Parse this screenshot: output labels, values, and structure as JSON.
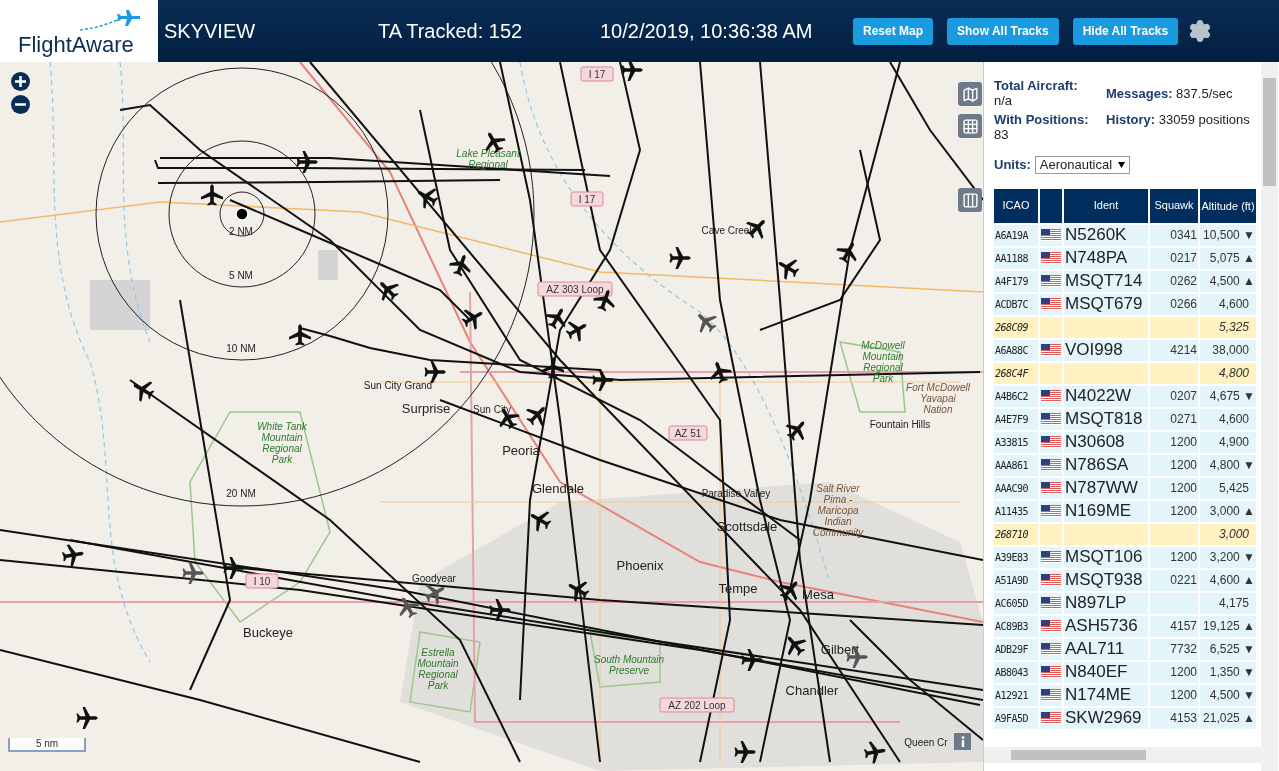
{
  "header": {
    "logo": "FlightAware",
    "title": "SKYVIEW",
    "tracked": "TA Tracked: 152",
    "datetime": "10/2/2019, 10:36:38 AM",
    "buttons": [
      "Reset Map",
      "Show All Tracks",
      "Hide All Tracks"
    ]
  },
  "map": {
    "scale": "5 nm",
    "labels": [
      {
        "kind": "road",
        "text": "I 17"
      },
      {
        "kind": "park",
        "text": "Lake Pleasant\nRegional"
      },
      {
        "kind": "road",
        "text": "I 17"
      },
      {
        "kind": "city",
        "text": "Cave Creek"
      },
      {
        "kind": "road",
        "text": "AZ 303 Loop"
      },
      {
        "kind": "city",
        "text": "Sun City Grand"
      },
      {
        "kind": "bigcity",
        "text": "Surprise"
      },
      {
        "kind": "city",
        "text": "Sun City"
      },
      {
        "kind": "park",
        "text": "McDowell\nMountain\nRegional\nPark"
      },
      {
        "kind": "reservation",
        "text": "Fort McDowell\nYavapai\nNation"
      },
      {
        "kind": "city",
        "text": "Fountain Hills"
      },
      {
        "kind": "park",
        "text": "White Tank\nMountain\nRegional\nPark"
      },
      {
        "kind": "bigcity",
        "text": "Peoria"
      },
      {
        "kind": "road",
        "text": "AZ 51"
      },
      {
        "kind": "bigcity",
        "text": "Glendale"
      },
      {
        "kind": "city",
        "text": "Paradise Valley"
      },
      {
        "kind": "reservation",
        "text": "Salt River\nPima -\nMaricopa\nIndian\nCommunity"
      },
      {
        "kind": "bigcity",
        "text": "Scottsdale"
      },
      {
        "kind": "bigcity",
        "text": "Phoenix"
      },
      {
        "kind": "road",
        "text": "I 10"
      },
      {
        "kind": "city",
        "text": "Goodyear"
      },
      {
        "kind": "bigcity",
        "text": "Tempe"
      },
      {
        "kind": "bigcity",
        "text": "Mesa"
      },
      {
        "kind": "bigcity",
        "text": "Buckeye"
      },
      {
        "kind": "park",
        "text": "Estrella\nMountain\nRegional\nPark"
      },
      {
        "kind": "park",
        "text": "South Mountain\nPreserve"
      },
      {
        "kind": "bigcity",
        "text": "Gilbert"
      },
      {
        "kind": "bigcity",
        "text": "Chandler"
      },
      {
        "kind": "road",
        "text": "AZ 202 Loop"
      },
      {
        "kind": "city",
        "text": "Queen Cr"
      },
      {
        "kind": "ring",
        "text": "2 NM"
      },
      {
        "kind": "ring",
        "text": "5 NM"
      },
      {
        "kind": "ring",
        "text": "10 NM"
      },
      {
        "kind": "ring",
        "text": "20 NM"
      }
    ]
  },
  "stats": [
    {
      "label": "Total Aircraft:",
      "value": "n/a"
    },
    {
      "label": "Messages:",
      "value": "837.5/sec"
    },
    {
      "label": "With Positions:",
      "value": "83"
    },
    {
      "label": "History:",
      "value": "33059 positions"
    }
  ],
  "units": {
    "label": "Units:",
    "value": "Aeronautical"
  },
  "table": {
    "columns": [
      "ICAO",
      "Ident",
      "Squawk",
      "Altitude (ft)"
    ],
    "rows": [
      {
        "icao": "A6A19A",
        "flag": true,
        "ident": "N5260K",
        "squawk": "0341",
        "altitude": "10,500",
        "trend": "▼",
        "highlighted": false
      },
      {
        "icao": "AA1188",
        "flag": true,
        "ident": "N748PA",
        "squawk": "0217",
        "altitude": "5,075",
        "trend": "▲",
        "highlighted": false
      },
      {
        "icao": "A4F179",
        "flag": true,
        "ident": "MSQT714",
        "squawk": "0262",
        "altitude": "4,500",
        "trend": "▲",
        "highlighted": false
      },
      {
        "icao": "ACDB7C",
        "flag": true,
        "ident": "MSQT679",
        "squawk": "0266",
        "altitude": "4,600",
        "highlighted": false
      },
      {
        "icao": "268C09",
        "flag": false,
        "altitude": "5,325",
        "highlighted": true
      },
      {
        "icao": "A6A88C",
        "flag": true,
        "ident": "VOI998",
        "squawk": "4214",
        "altitude": "38,000",
        "highlighted": false
      },
      {
        "icao": "268C4F",
        "flag": false,
        "altitude": "4,800",
        "highlighted": true
      },
      {
        "icao": "A4B6C2",
        "flag": true,
        "ident": "N4022W",
        "squawk": "0207",
        "altitude": "4,675",
        "trend": "▼",
        "highlighted": false
      },
      {
        "icao": "A4E7F9",
        "flag": true,
        "ident": "MSQT818",
        "squawk": "0271",
        "altitude": "4,600",
        "highlighted": false
      },
      {
        "icao": "A33815",
        "flag": true,
        "ident": "N30608",
        "squawk": "1200",
        "altitude": "4,900",
        "highlighted": false
      },
      {
        "icao": "AAA861",
        "flag": true,
        "ident": "N786SA",
        "squawk": "1200",
        "altitude": "4,800",
        "trend": "▼",
        "highlighted": false
      },
      {
        "icao": "AAAC90",
        "flag": true,
        "ident": "N787WW",
        "squawk": "1200",
        "altitude": "5,425",
        "highlighted": false
      },
      {
        "icao": "A11435",
        "flag": true,
        "ident": "N169ME",
        "squawk": "1200",
        "altitude": "3,000",
        "trend": "▲",
        "highlighted": false
      },
      {
        "icao": "268710",
        "flag": false,
        "altitude": "3,000",
        "highlighted": true
      },
      {
        "icao": "A39E83",
        "flag": true,
        "ident": "MSQT106",
        "squawk": "1200",
        "altitude": "3,200",
        "trend": "▼",
        "highlighted": false
      },
      {
        "icao": "A51A9D",
        "flag": true,
        "ident": "MSQT938",
        "squawk": "0221",
        "altitude": "4,600",
        "trend": "▲",
        "highlighted": false
      },
      {
        "icao": "AC605D",
        "flag": true,
        "ident": "N897LP",
        "altitude": "4,175",
        "highlighted": false
      },
      {
        "icao": "AC89B3",
        "flag": true,
        "ident": "ASH5736",
        "squawk": "4157",
        "altitude": "19,125",
        "trend": "▲",
        "highlighted": false
      },
      {
        "icao": "ADB29F",
        "flag": true,
        "ident": "AAL711",
        "squawk": "7732",
        "altitude": "6,525",
        "trend": "▼",
        "highlighted": false
      },
      {
        "icao": "AB8043",
        "flag": true,
        "ident": "N840EF",
        "squawk": "1200",
        "altitude": "1,350",
        "trend": "▼",
        "highlighted": false
      },
      {
        "icao": "A12921",
        "flag": true,
        "ident": "N174ME",
        "squawk": "1200",
        "altitude": "4,500",
        "trend": "▼",
        "highlighted": false
      },
      {
        "icao": "A9FA5D",
        "flag": true,
        "ident": "SKW2969",
        "squawk": "4153",
        "altitude": "21,025",
        "trend": "▲",
        "highlighted": false
      }
    ]
  }
}
